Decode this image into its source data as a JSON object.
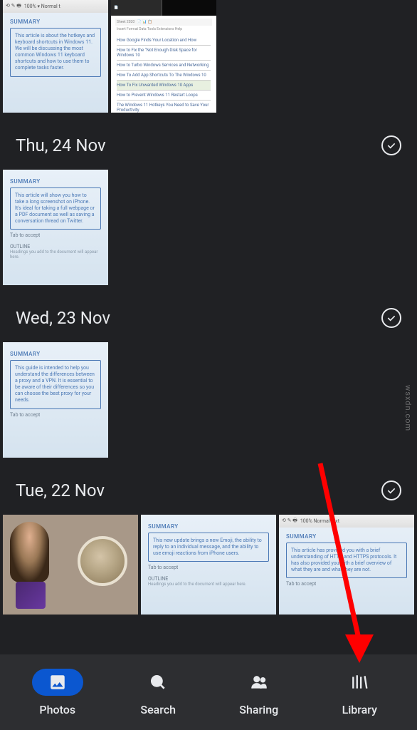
{
  "top_row": {
    "photo1": {
      "toolbar": "100% ▾   Normal t",
      "summary_label": "SUMMARY",
      "summary_text": "This article is about the hotkeys and keyboard shortcuts in Windows 11. We will be discussing the most common Windows 11 keyboard shortcuts and how to use them to complete tasks faster."
    },
    "photo2": {
      "lines": [
        "How Google Finds Your Location and How",
        "How to Fix the \"Not Enough Disk Space for Windows 10",
        "How to Turbo Windows Services and Networking",
        "How To Add App Shortcuts To The Windows 10",
        "How To Fix Unwanted Windows 10 Apps",
        "How to Prevent Windows 11 Restart Loops",
        "The Windows 11 Hotkeys You Need to Save Your Productivity"
      ]
    }
  },
  "dates": {
    "d1": "Thu, 24 Nov",
    "d2": "Wed, 23 Nov",
    "d3": "Tue, 22 Nov"
  },
  "section1": {
    "photo": {
      "summary_label": "SUMMARY",
      "summary_text": "This article will show you how to take a long screenshot on iPhone. It's ideal for taking a full webpage or a PDF document as well as saving a conversation thread on Twitter.",
      "tab_accept": "Tab to accept",
      "outline_label": "OUTLINE",
      "outline_text": "Headings you add to the document will appear here."
    }
  },
  "section2": {
    "photo": {
      "summary_label": "SUMMARY",
      "summary_text": "This guide is intended to help you understand the differences between a proxy and a VPN. It is essential to be aware of their differences so you can choose the best proxy for your needs.",
      "tab_accept": "Tab to accept"
    }
  },
  "section3": {
    "photo2": {
      "summary_label": "SUMMARY",
      "summary_text": "This new update brings a new Emoji, the ability to reply to an individual message, and the ability to use emoji reactions from iPhone users.",
      "tab_accept": "Tab to accept",
      "outline_label": "OUTLINE",
      "outline_text": "Headings you add to the document will appear here."
    },
    "photo3": {
      "toolbar": "100%    Normal text",
      "summary_label": "SUMMARY",
      "summary_text": "This article has provided you with a brief understanding of HTTP and HTTPS protocols. It has also provided you with a brief overview of what they are and what they are not.",
      "tab_accept": "Tab to accept"
    }
  },
  "nav": {
    "photos": "Photos",
    "search": "Search",
    "sharing": "Sharing",
    "library": "Library"
  },
  "watermark": "wsxdn.com"
}
